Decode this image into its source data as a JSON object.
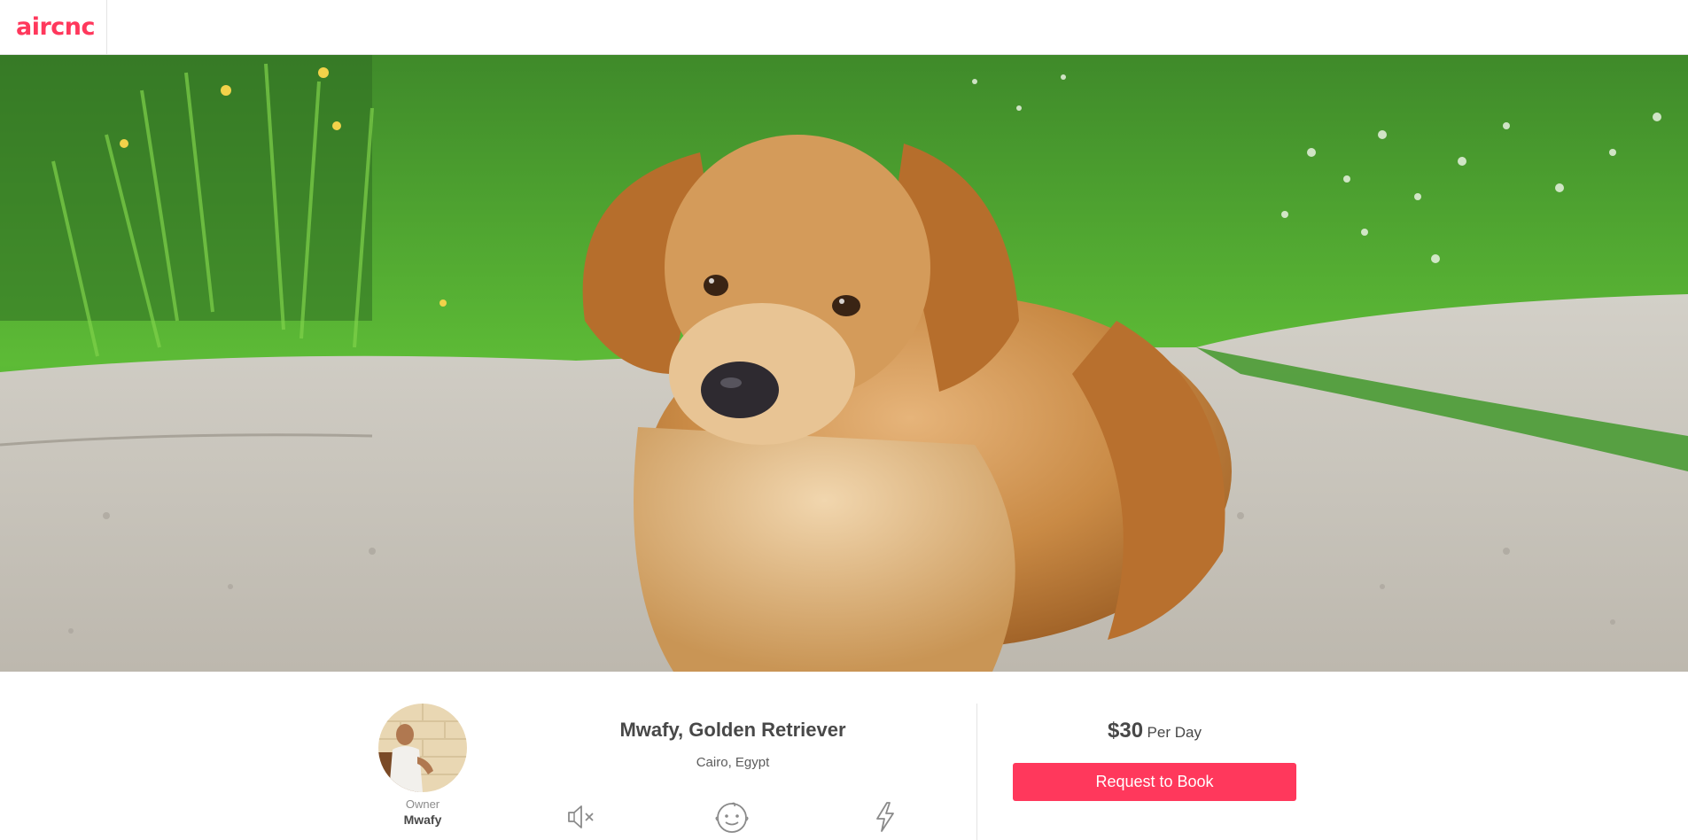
{
  "app": {
    "logo_text": "aircnc",
    "brand_color": "#ff385c"
  },
  "hero": {
    "image_alt": "Golden retriever lying on concrete in front of grass"
  },
  "owner": {
    "label": "Owner",
    "name": "Mwafy",
    "avatar_icon": "owner-avatar"
  },
  "listing": {
    "title": "Mwafy, Golden Retriever",
    "location": "Cairo, Egypt",
    "amenities": [
      {
        "icon": "muted-speaker-icon"
      },
      {
        "icon": "baby-face-icon"
      },
      {
        "icon": "lightning-bolt-icon"
      }
    ]
  },
  "booking": {
    "price": "$30",
    "unit": "Per Day",
    "button_label": "Request to Book",
    "button_color": "#ff385c"
  }
}
